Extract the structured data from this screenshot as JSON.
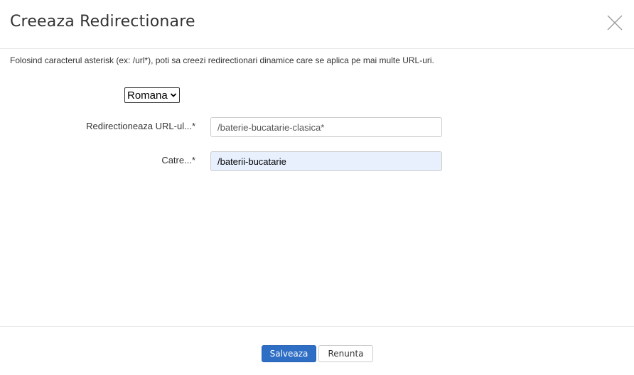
{
  "dialog": {
    "title": "Creeaza Redirectionare",
    "close_icon": "close-icon"
  },
  "hint": "Folosind caracterul asterisk (ex: /url*), poti sa creezi redirectionari dinamice care se aplica pe mai multe URL-uri.",
  "language_select": {
    "selected": "Romana",
    "icon": "chevron-down-icon"
  },
  "form": {
    "from_label": "Redirectioneaza URL-ul...*",
    "from_value": "/baterie-bucatarie-clasica*",
    "to_label": "Catre...*",
    "to_value": "/baterii-bucatarie"
  },
  "footer": {
    "save_label": "Salveaza",
    "cancel_label": "Renunta"
  },
  "colors": {
    "primary": "#2e6ec5",
    "autofill_bg": "#e8f0fe",
    "border": "#cccccc"
  }
}
